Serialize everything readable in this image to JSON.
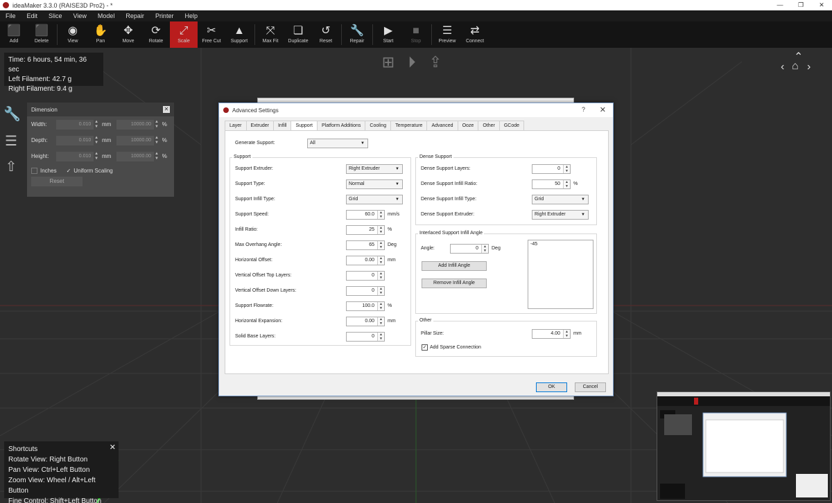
{
  "window": {
    "title": "ideaMaker 3.3.0 (RAISE3D Pro2) - *",
    "controls": [
      "—",
      "❐",
      "✕"
    ]
  },
  "menu": [
    "File",
    "Edit",
    "Slice",
    "View",
    "Model",
    "Repair",
    "Printer",
    "Help"
  ],
  "toolbar": [
    {
      "label": "Add",
      "icon": "cube-add-icon",
      "glyph": "⬛"
    },
    {
      "label": "Delete",
      "icon": "cube-delete-icon",
      "glyph": "⬛"
    },
    {
      "label": "View",
      "icon": "eye-icon",
      "glyph": "👁"
    },
    {
      "label": "Pan",
      "icon": "hand-icon",
      "glyph": "✋"
    },
    {
      "label": "Move",
      "icon": "move-arrows-icon",
      "glyph": "✥"
    },
    {
      "label": "Rotate",
      "icon": "rotate-icon",
      "glyph": "⟳"
    },
    {
      "label": "Scale",
      "icon": "scale-icon",
      "glyph": "⤢"
    },
    {
      "label": "Free Cut",
      "icon": "knife-icon",
      "glyph": "✂"
    },
    {
      "label": "Support",
      "icon": "support-icon",
      "glyph": "▲"
    },
    {
      "label": "Max Fit",
      "icon": "max-fit-icon",
      "glyph": "⤧"
    },
    {
      "label": "Duplicate",
      "icon": "duplicate-icon",
      "glyph": "❏"
    },
    {
      "label": "Reset",
      "icon": "reset-icon",
      "glyph": "↺"
    },
    {
      "label": "Repair",
      "icon": "wrench-icon",
      "glyph": "🔧"
    },
    {
      "label": "Start",
      "icon": "play-icon",
      "glyph": "▶"
    },
    {
      "label": "Stop",
      "icon": "stop-icon",
      "glyph": "■"
    },
    {
      "label": "Preview",
      "icon": "preview-layers-icon",
      "glyph": "☰"
    },
    {
      "label": "Connect",
      "icon": "connect-icon",
      "glyph": "⇄"
    }
  ],
  "active_tool": "Scale",
  "accent": "#b91d1d",
  "info": {
    "time": "Time: 6 hours, 54 min, 36 sec",
    "left_filament": "Left Filament: 42.7 g",
    "right_filament": "Right Filament: 9.4 g"
  },
  "dimension": {
    "title": "Dimension",
    "rows": [
      {
        "label": "Width:",
        "value": "0.010",
        "unit": "mm",
        "pct": "10000.00",
        "pct_unit": "%"
      },
      {
        "label": "Depth:",
        "value": "0.010",
        "unit": "mm",
        "pct": "10000.00",
        "pct_unit": "%"
      },
      {
        "label": "Height:",
        "value": "0.010",
        "unit": "mm",
        "pct": "10000.00",
        "pct_unit": "%"
      }
    ],
    "inches": "Inches",
    "uniform": "Uniform Scaling",
    "reset": "Reset"
  },
  "shortcuts": {
    "title": "Shortcuts",
    "lines": [
      "Rotate View: Right Button",
      "Pan View: Ctrl+Left Button",
      "Zoom View: Wheel / Alt+Left Button",
      "Fine Control: Shift+Left Button"
    ]
  },
  "dialog": {
    "title": "Advanced Settings",
    "help": "?",
    "close": "✕",
    "tabs": [
      "Layer",
      "Extruder",
      "Infill",
      "Support",
      "Platform Additions",
      "Cooling",
      "Temperature",
      "Advanced",
      "Ooze",
      "Other",
      "GCode"
    ],
    "selected_tab": "Support",
    "generate_support": {
      "label": "Generate Support:",
      "value": "All"
    },
    "support_group": {
      "title": "Support",
      "extruder": {
        "label": "Support Extruder:",
        "value": "Right Extruder"
      },
      "type": {
        "label": "Support Type:",
        "value": "Normal"
      },
      "infill_type": {
        "label": "Support Infill Type:",
        "value": "Grid"
      },
      "speed": {
        "label": "Support Speed:",
        "value": "60.0",
        "unit": "mm/s"
      },
      "infill_ratio": {
        "label": "Infill Ratio:",
        "value": "25",
        "unit": "%"
      },
      "overhang": {
        "label": "Max Overhang Angle:",
        "value": "65",
        "unit": "Deg"
      },
      "h_offset": {
        "label": "Horizontal Offset:",
        "value": "0.00",
        "unit": "mm"
      },
      "v_top": {
        "label": "Vertical Offset Top Layers:",
        "value": "0"
      },
      "v_down": {
        "label": "Vertical Offset Down Layers:",
        "value": "0"
      },
      "flowrate": {
        "label": "Support Flowrate:",
        "value": "100.0",
        "unit": "%"
      },
      "h_expansion": {
        "label": "Horizontal Expansion:",
        "value": "0.00",
        "unit": "mm"
      },
      "solid_base": {
        "label": "Solid Base Layers:",
        "value": "0"
      }
    },
    "dense_group": {
      "title": "Dense Support",
      "layers": {
        "label": "Dense Support Layers:",
        "value": "0"
      },
      "infill_ratio": {
        "label": "Dense Support Infill Ratio:",
        "value": "50",
        "unit": "%"
      },
      "infill_type": {
        "label": "Dense Support Infill Type:",
        "value": "Grid"
      },
      "extruder": {
        "label": "Dense Support Extruder:",
        "value": "Right Extruder"
      }
    },
    "interlaced_group": {
      "title": "Interlaced Support Infill Angle",
      "angle": {
        "label": "Angle:",
        "value": "0",
        "unit": "Deg"
      },
      "add": "Add Infill Angle",
      "remove": "Remove Infill Angle",
      "list": [
        "-45"
      ]
    },
    "other_group": {
      "title": "Other",
      "pillar": {
        "label": "Pillar Size:",
        "value": "4.00",
        "unit": "mm"
      },
      "sparse": {
        "label": "Add Sparse Connection",
        "checked": true
      }
    },
    "ok": "OK",
    "cancel": "Cancel"
  }
}
